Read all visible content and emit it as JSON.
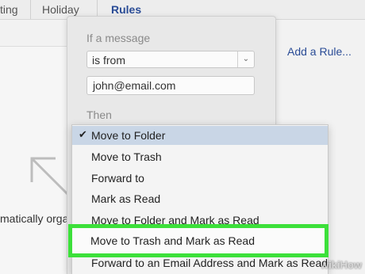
{
  "tabs": [
    {
      "label": "ting"
    },
    {
      "label": "Holiday"
    },
    {
      "label": "Rules"
    }
  ],
  "add_rule_label": "Add a Rule...",
  "background_text": "matically orga",
  "dialog": {
    "if_label": "If a message",
    "condition_value": "is from",
    "email_value": "john@email.com",
    "then_label": "Then"
  },
  "menu": {
    "items": [
      {
        "label": "Move to Folder",
        "checked": true
      },
      {
        "label": "Move to Trash"
      },
      {
        "label": "Forward to"
      },
      {
        "label": "Mark as Read"
      },
      {
        "label": "Move to Folder and Mark as Read"
      },
      {
        "label": "Move to Trash and Mark as Read",
        "highlighted": true
      },
      {
        "label": "Forward to an Email Address and Mark as Read"
      }
    ],
    "check_glyph": "✔"
  },
  "watermark": "wikiHow",
  "colors": {
    "highlight": "#3ce03a",
    "link": "#2a4c96",
    "selected_row": "#c9d6e6"
  }
}
